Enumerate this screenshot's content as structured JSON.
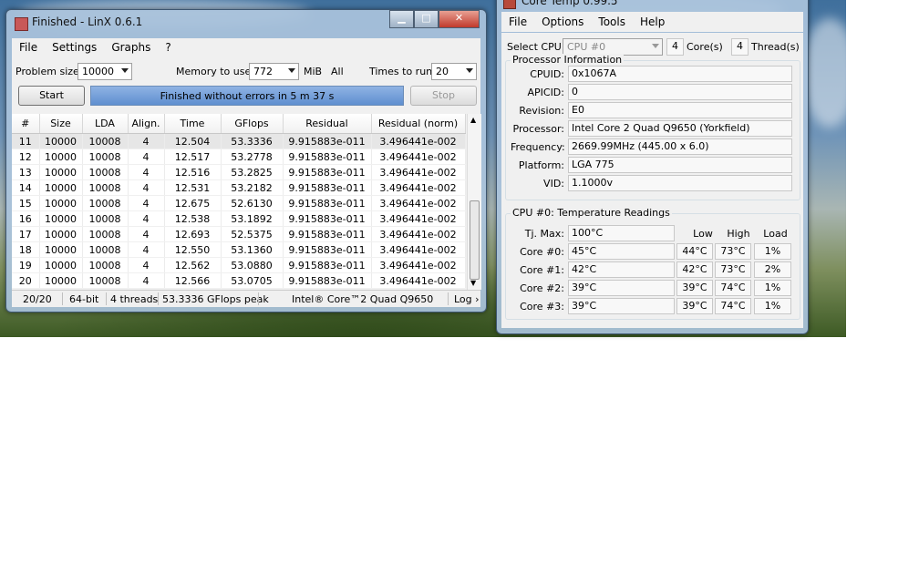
{
  "linx": {
    "title": "Finished - LinX 0.6.1",
    "menu": [
      "File",
      "Settings",
      "Graphs",
      "?"
    ],
    "problem_size_label": "Problem size:",
    "problem_size_value": "10000",
    "memory_label": "Memory to use:",
    "memory_value": "772",
    "memory_unit": "MiB",
    "memory_all": "All",
    "times_label": "Times to run:",
    "times_value": "20",
    "start_label": "Start",
    "stop_label": "Stop",
    "progress_text": "Finished without errors in 5 m 37 s",
    "progress_fraction": 1.0,
    "columns": [
      "#",
      "Size",
      "LDA",
      "Align.",
      "Time",
      "GFlops",
      "Residual",
      "Residual (norm)"
    ],
    "rows": [
      [
        "11",
        "10000",
        "10008",
        "4",
        "12.504",
        "53.3336",
        "9.915883e-011",
        "3.496441e-002"
      ],
      [
        "12",
        "10000",
        "10008",
        "4",
        "12.517",
        "53.2778",
        "9.915883e-011",
        "3.496441e-002"
      ],
      [
        "13",
        "10000",
        "10008",
        "4",
        "12.516",
        "53.2825",
        "9.915883e-011",
        "3.496441e-002"
      ],
      [
        "14",
        "10000",
        "10008",
        "4",
        "12.531",
        "53.2182",
        "9.915883e-011",
        "3.496441e-002"
      ],
      [
        "15",
        "10000",
        "10008",
        "4",
        "12.675",
        "52.6130",
        "9.915883e-011",
        "3.496441e-002"
      ],
      [
        "16",
        "10000",
        "10008",
        "4",
        "12.538",
        "53.1892",
        "9.915883e-011",
        "3.496441e-002"
      ],
      [
        "17",
        "10000",
        "10008",
        "4",
        "12.693",
        "52.5375",
        "9.915883e-011",
        "3.496441e-002"
      ],
      [
        "18",
        "10000",
        "10008",
        "4",
        "12.550",
        "53.1360",
        "9.915883e-011",
        "3.496441e-002"
      ],
      [
        "19",
        "10000",
        "10008",
        "4",
        "12.562",
        "53.0880",
        "9.915883e-011",
        "3.496441e-002"
      ],
      [
        "20",
        "10000",
        "10008",
        "4",
        "12.566",
        "53.0705",
        "9.915883e-011",
        "3.496441e-002"
      ]
    ],
    "status": {
      "progress": "20/20",
      "bits": "64-bit",
      "threads": "4 threads",
      "peak": "53.3336 GFlops peak",
      "cpu": "Intel® Core™2 Quad Q9650",
      "log": "Log ›"
    }
  },
  "coretemp": {
    "title": "Core Temp 0.99.5",
    "menu": [
      "File",
      "Options",
      "Tools",
      "Help"
    ],
    "select_cpu_label": "Select CPU:",
    "select_cpu_value": "CPU #0",
    "cores_count": "4",
    "cores_label": "Core(s)",
    "threads_count": "4",
    "threads_label": "Thread(s)",
    "proc_info_title": "Processor Information",
    "info": [
      {
        "label": "CPUID:",
        "value": "0x1067A"
      },
      {
        "label": "APICID:",
        "value": "0"
      },
      {
        "label": "Revision:",
        "value": "E0"
      },
      {
        "label": "Processor:",
        "value": "Intel Core 2 Quad Q9650 (Yorkfield)"
      },
      {
        "label": "Frequency:",
        "value": "2669.99MHz (445.00 x 6.0)"
      },
      {
        "label": "Platform:",
        "value": "LGA 775"
      },
      {
        "label": "VID:",
        "value": "1.1000v"
      }
    ],
    "temp_title": "CPU #0: Temperature Readings",
    "col_low": "Low",
    "col_high": "High",
    "col_load": "Load",
    "tjmax_label": "Tj. Max:",
    "tjmax_value": "100°C",
    "cores": [
      {
        "label": "Core #0:",
        "temp": "45°C",
        "low": "44°C",
        "high": "73°C",
        "load": "1%"
      },
      {
        "label": "Core #1:",
        "temp": "42°C",
        "low": "42°C",
        "high": "73°C",
        "load": "2%"
      },
      {
        "label": "Core #2:",
        "temp": "39°C",
        "low": "39°C",
        "high": "74°C",
        "load": "1%"
      },
      {
        "label": "Core #3:",
        "temp": "39°C",
        "low": "39°C",
        "high": "74°C",
        "load": "1%"
      }
    ]
  },
  "colors": {
    "progress_fill": "#5f8fd0",
    "window_glass": "#aac3dc",
    "close_button": "#c0392b"
  }
}
